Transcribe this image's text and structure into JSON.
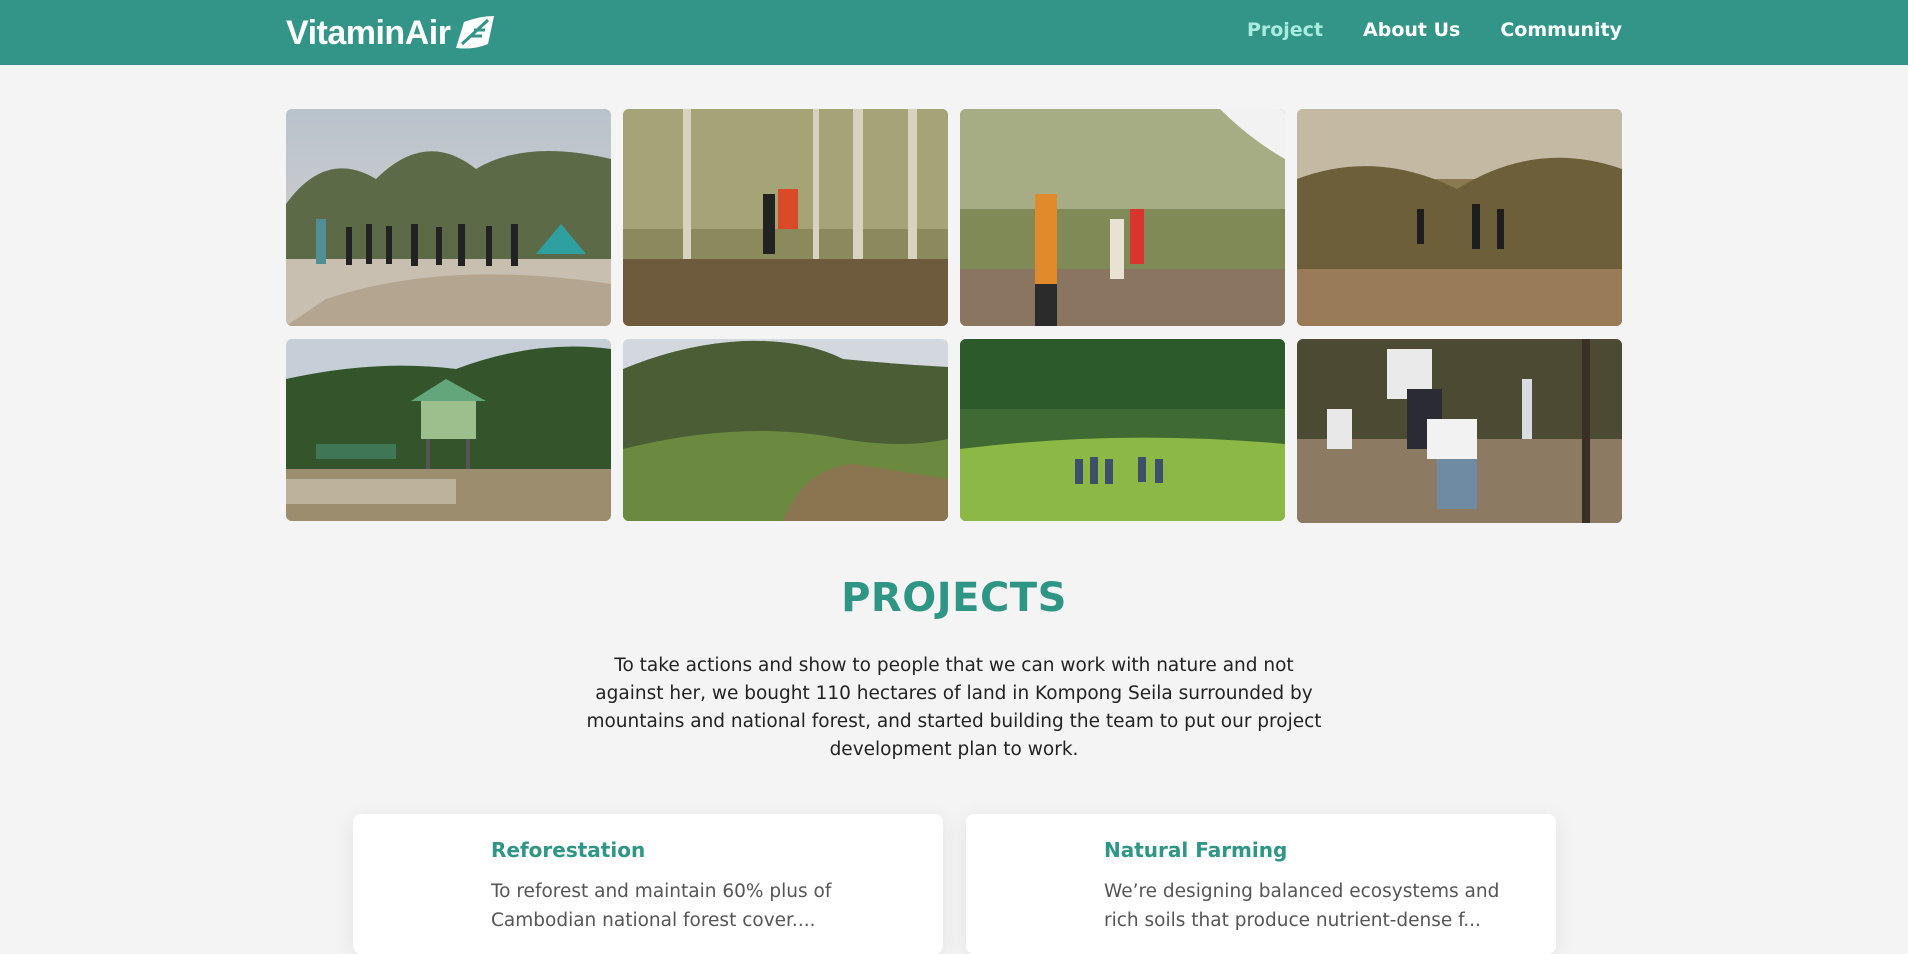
{
  "header": {
    "logo_text": "VitaminAir",
    "nav": [
      {
        "label": "Project",
        "active": true
      },
      {
        "label": "About Us",
        "active": false
      },
      {
        "label": "Community",
        "active": false
      }
    ]
  },
  "gallery": {
    "photos": [
      {
        "name": "photo-group-camping"
      },
      {
        "name": "photo-forest-trekking"
      },
      {
        "name": "photo-forest-group"
      },
      {
        "name": "photo-dry-forest"
      },
      {
        "name": "photo-stilt-house"
      },
      {
        "name": "photo-mountain"
      },
      {
        "name": "photo-hiking-field"
      },
      {
        "name": "photo-tree-planting"
      }
    ]
  },
  "projects": {
    "title": "PROJECTS",
    "description": "To take actions and show to people that we can work with nature and not against her, we bought 110 hectares of land in Kompong Seila surrounded by mountains and national forest, and started building the team to put our project development plan to work.",
    "cards": [
      {
        "title": "Reforestation",
        "text": "To reforest and maintain 60% plus of Cambodian national forest cover...."
      },
      {
        "title": "Natural Farming",
        "text": "We’re designing balanced ecosystems and rich soils that produce nutrient-dense f..."
      }
    ]
  },
  "colors": {
    "brand": "#329587",
    "title": "#2f9585",
    "nav_active": "#a9ecdf"
  }
}
